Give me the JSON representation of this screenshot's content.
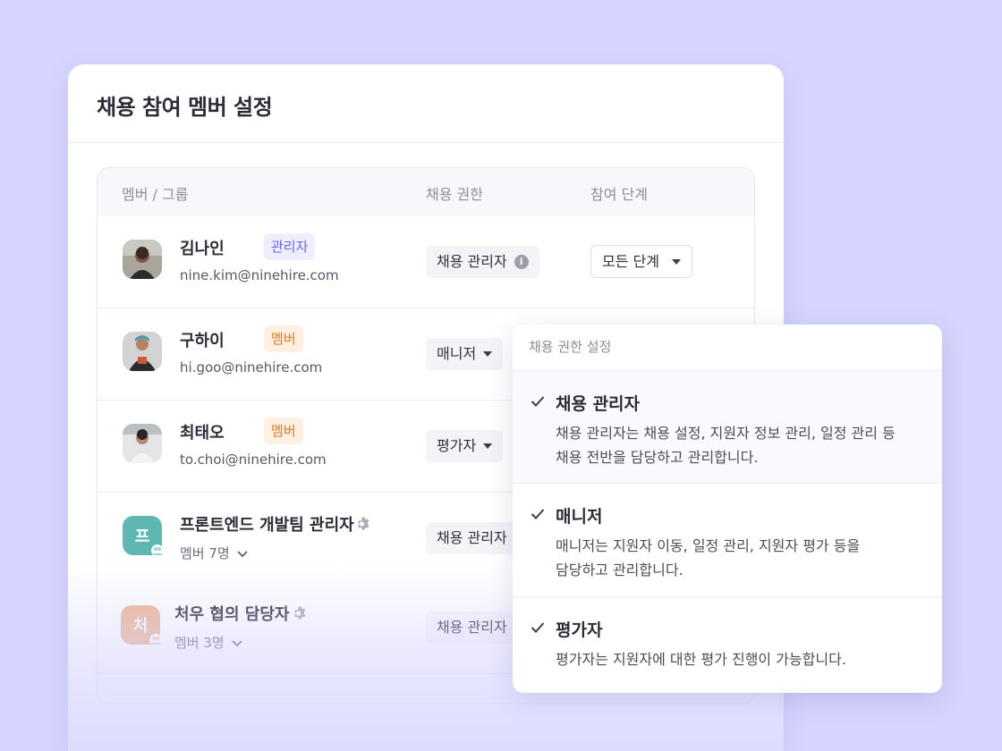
{
  "card": {
    "title": "채용 참여 멤버 설정"
  },
  "table": {
    "headers": {
      "member": "멤버 / 그룹",
      "permission": "채용 권한",
      "stage": "참여 단계"
    },
    "rows": [
      {
        "name": "김나인",
        "tag": "관리자",
        "email": "nine.kim@ninehire.com",
        "permission": "채용 관리자",
        "stage": "모든 단계"
      },
      {
        "name": "구하이",
        "tag": "멤버",
        "email": "hi.goo@ninehire.com",
        "permission": "매니저"
      },
      {
        "name": "최태오",
        "tag": "멤버",
        "email": "to.choi@ninehire.com",
        "permission": "평가자"
      },
      {
        "name": "프론트엔드 개발팀 관리자",
        "avatar_letter": "프",
        "count": "멤버 7명",
        "permission": "채용 관리자"
      },
      {
        "name": "처우 협의 담당자",
        "avatar_letter": "처",
        "count": "멤버 3명",
        "permission": "채용 관리자"
      }
    ]
  },
  "dropdown": {
    "header": "채용 권한 설정",
    "options": [
      {
        "title": "채용 관리자",
        "desc_lines": [
          "채용 관리자는 채용 설정, 지원자 정보 관리, 일정 관리 등",
          "채용 전반을 담당하고 관리합니다."
        ]
      },
      {
        "title": "매니저",
        "desc_lines": [
          "매니저는 지원자 이동, 일정 관리, 지원자 평가 등을",
          "담당하고 관리합니다."
        ]
      },
      {
        "title": "평가자",
        "desc_lines": [
          "평가자는 지원자에 대한 평가 진행이 가능합니다."
        ]
      }
    ]
  },
  "colors": {
    "background": "#d6d5ff",
    "admin_tag": "#6c63e6",
    "member_tag": "#e0781e",
    "group_frontend": "#5fb7b2",
    "group_offer": "#eeb695"
  },
  "icons": {
    "info": "info-icon",
    "gear": "gear-icon",
    "chevron": "chevron-down-icon",
    "check": "check-icon",
    "caret": "caret-down-icon",
    "group": "group-icon"
  }
}
